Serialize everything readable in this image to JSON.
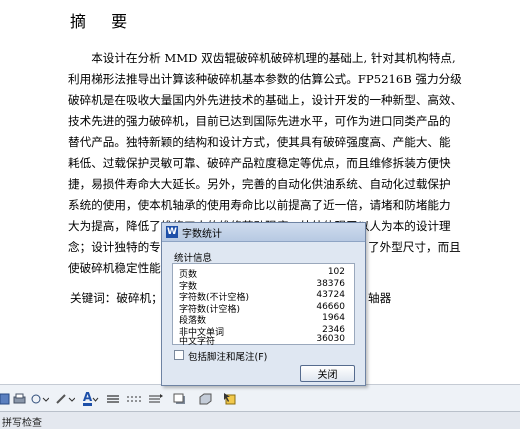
{
  "document": {
    "title": "摘 要",
    "paragraph_lines": [
      "　　本设计在分析 MMD 双齿辊破碎机破碎机理的基础上, 针对其机构特点,",
      "利用梯形法推导出计算该种破碎机基本参数的估算公式。FP5216B 强力分级",
      "破碎机是在吸收大量国内外先进技术的基础上，设计开发的一种新型、高效、",
      "技术先进的强力破碎机，目前已达到国际先进水平，可作为进口同类产品的",
      "替代产品。独特新颖的结构和设计方式，使其具有破碎强度高、产能大、能",
      "耗低、过载保护灵敏可靠、破碎产品粒度稳定等优点，而且维修拆装方便快",
      "捷，易损件寿命大大延长。另外，完善的自动化供油系统、自动化过载保护",
      "系统的使用，使本机轴承的使用寿命比以前提高了近一倍，请堵和防堵能力",
      "大为提高，降低了维修工人的维修劳动强度，处处体现了以人为本的设计理",
      "念；设计独特的专",
      "使破碎机稳定性能"
    ],
    "line10_tail": "了外型尺寸，而且",
    "keywords_label": "关键词：破碎机；",
    "keywords_tail": "轴器"
  },
  "statusbar": {
    "text": "拼写检查"
  },
  "dialog": {
    "icon_letter": "W",
    "title": "字数统计",
    "section_label": "统计信息",
    "stats": [
      {
        "label": "页数",
        "value": "102"
      },
      {
        "label": "字数",
        "value": "38376"
      },
      {
        "label": "字符数(不计空格)",
        "value": "43724"
      },
      {
        "label": "字符数(计空格)",
        "value": "46660"
      },
      {
        "label": "段落数",
        "value": "1964"
      },
      {
        "label": "非中文单词",
        "value": "2346"
      },
      {
        "label": "中文字符",
        "value": "36030"
      }
    ],
    "footnote_checkbox_label": "包括脚注和尾注(F)",
    "footnote_checked": false,
    "close_button": "关闭"
  },
  "toolbar": {
    "icons": [
      "save-icon",
      "print-icon",
      "shapes-icon",
      "line-color-icon",
      "font-color-icon",
      "line-style-icon",
      "dash-style-icon",
      "arrow-style-icon",
      "shadow-icon",
      "3d-icon",
      "select-objects-icon"
    ],
    "font_color_glyph": "A",
    "accent_color": "#1d4fa8"
  }
}
